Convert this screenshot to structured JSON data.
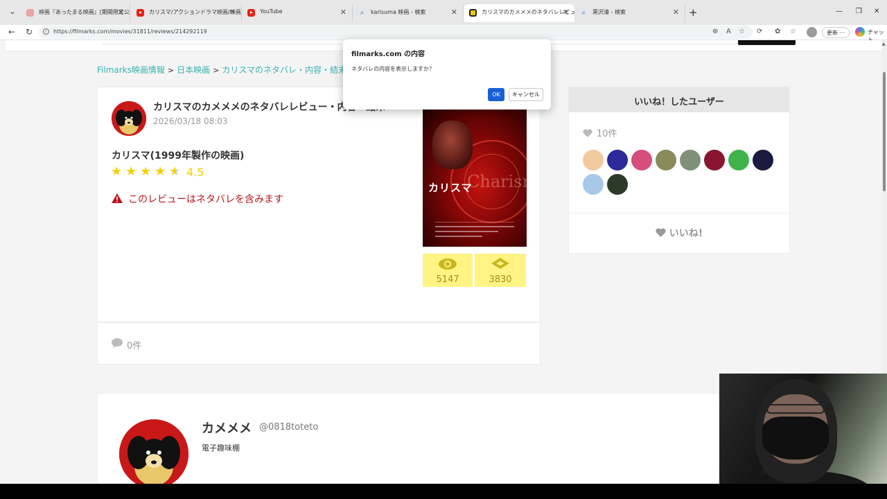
{
  "browser": {
    "tabs": [
      {
        "label": "映画『あったまる映画』[期間限定公開",
        "favicon": "youtube"
      },
      {
        "label": "カリスマ/アクションドラマ映画/映画邦画",
        "favicon": "youtube"
      },
      {
        "label": "YouTube",
        "favicon": "youtube"
      },
      {
        "label": "karisuma 映画 - 検索",
        "favicon": "search"
      },
      {
        "label": "カリスマのカメメメのネタバレレビュー・内容",
        "favicon": "filmarks"
      },
      {
        "label": "黒沢清 - 検索",
        "favicon": "search"
      }
    ],
    "url": "https://filmarks.com/movies/31811/reviews/214292119",
    "update_label": "更新",
    "chat_label": "チャット"
  },
  "breadcrumb": [
    "Filmarks映画情報",
    "日本映画",
    "カリスマのネタバレ・内容・結末"
  ],
  "review": {
    "title": "カリスマのカメメメのネタバレレビュー・内容・結末",
    "date": "2026/03/18 08:03",
    "movie_title": "カリスマ(1999年製作の映画)",
    "rating": 4.5,
    "rating_label": "4.5",
    "spoiler_warning": "このレビューはネタバレを含みます",
    "comment_count": "0件"
  },
  "poster": {
    "title_jp": "カリスマ",
    "title_en": "Charisma"
  },
  "stats": {
    "watched": "5147",
    "clipped": "3830"
  },
  "likes": {
    "heading": "いいね！したユーザー",
    "count": "10件",
    "button_label": "いいね!",
    "user_colors": [
      "#f3c9a0",
      "#2a2a9a",
      "#d54d7a",
      "#8a8a5a",
      "#7e8f7a",
      "#8a1530",
      "#3fb24a",
      "#1a1a40",
      "#a8c8e8",
      "#2d3a2a"
    ]
  },
  "profile": {
    "name": "カメメメ",
    "handle": "@0818toteto",
    "bio": "電子趣味棚"
  },
  "dialog": {
    "title": "filmarks.com の内容",
    "message": "ネタバレの内容を表示しますか？",
    "ok_label": "OK",
    "cancel_label": "キャンセル"
  },
  "colors": {
    "accent": "#39b4b0",
    "star": "#f5d000",
    "spoiler": "#b8141b",
    "stat_bg": "#fff384",
    "dialog_ok": "#1a5fd6"
  }
}
